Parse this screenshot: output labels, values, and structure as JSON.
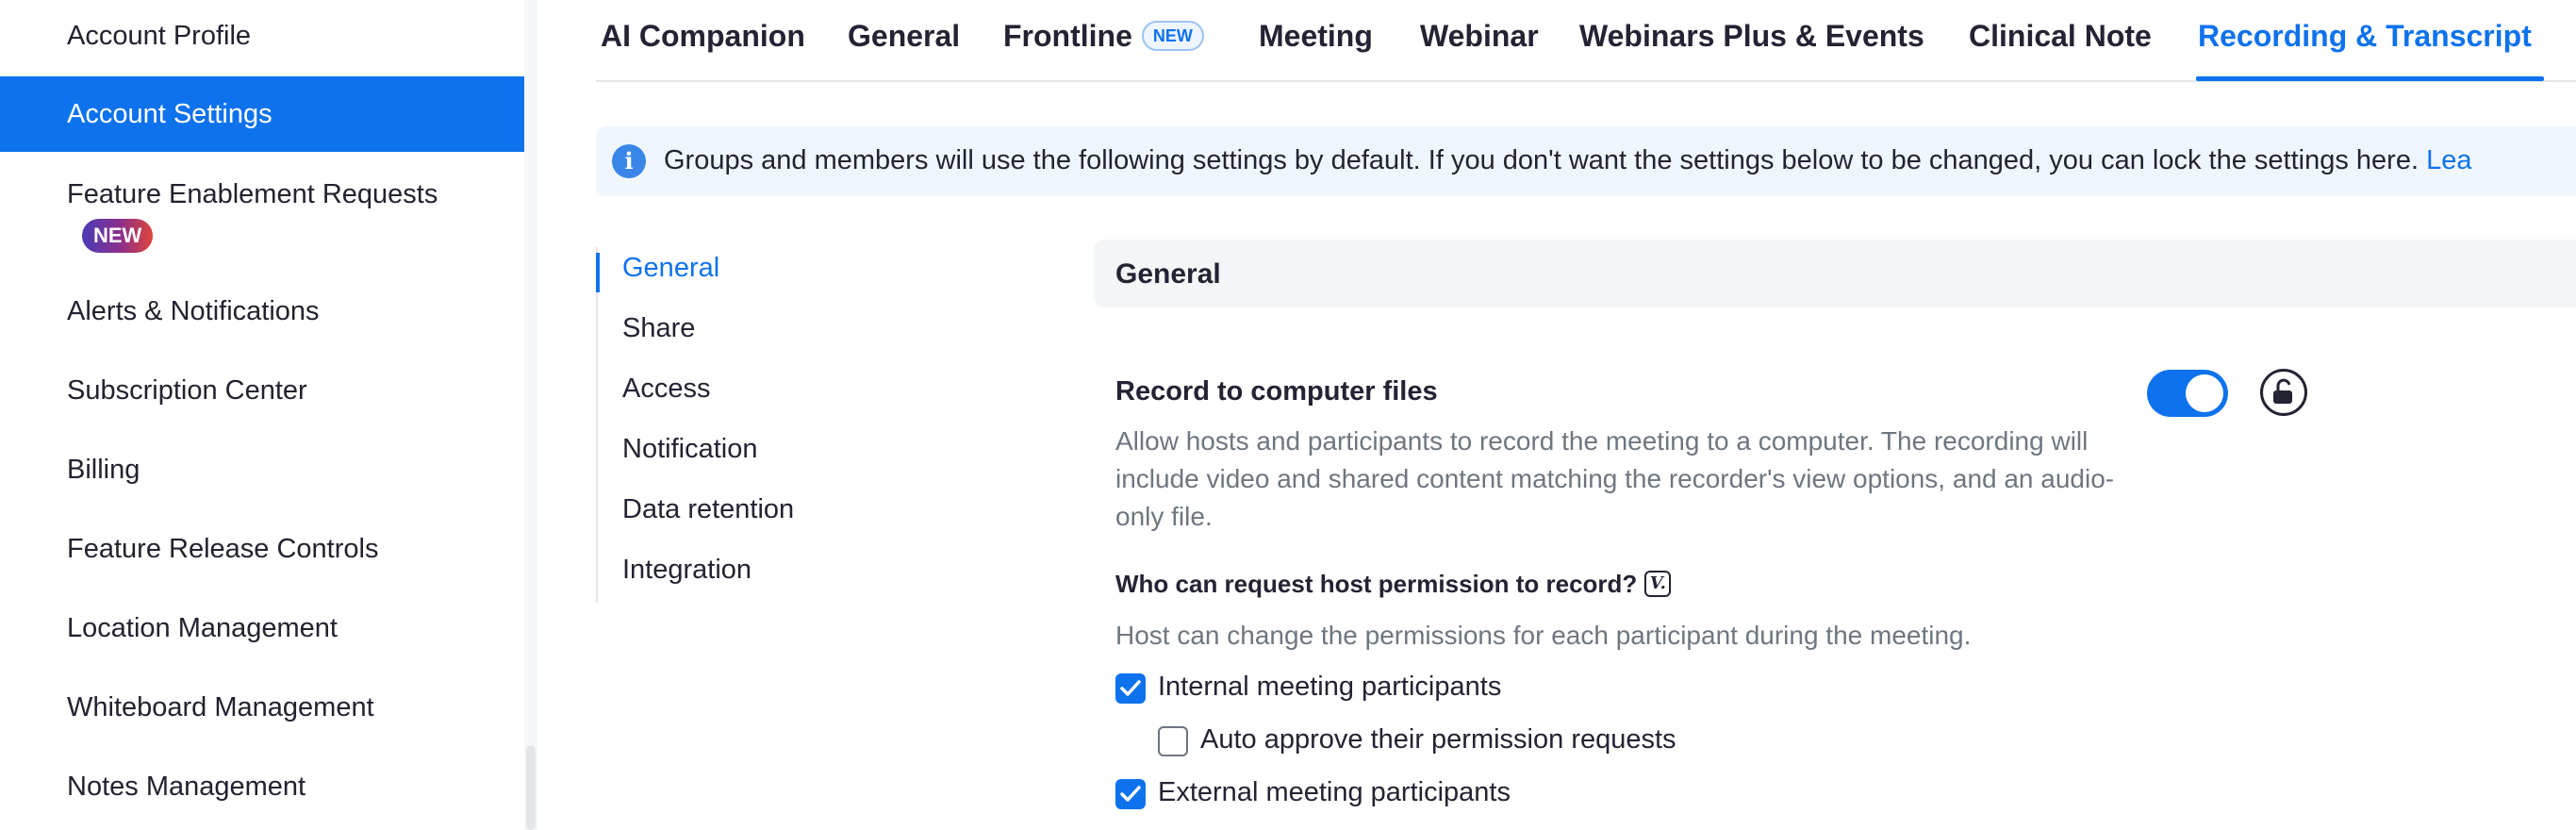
{
  "sidebar": {
    "items": [
      {
        "label": "Account Profile"
      },
      {
        "label": "Account Settings"
      },
      {
        "label": "Feature Enablement Requests",
        "badge": "NEW"
      },
      {
        "label": "Alerts & Notifications"
      },
      {
        "label": "Subscription Center"
      },
      {
        "label": "Billing"
      },
      {
        "label": "Feature Release Controls"
      },
      {
        "label": "Location Management"
      },
      {
        "label": "Whiteboard Management"
      },
      {
        "label": "Notes Management"
      }
    ],
    "active_index": 1
  },
  "tabs": {
    "items": [
      {
        "label": "AI Companion"
      },
      {
        "label": "General"
      },
      {
        "label": "Frontline",
        "badge": "NEW"
      },
      {
        "label": "Meeting"
      },
      {
        "label": "Webinar"
      },
      {
        "label": "Webinars Plus & Events"
      },
      {
        "label": "Clinical Note"
      },
      {
        "label": "Recording & Transcript"
      }
    ],
    "active_index": 7
  },
  "banner": {
    "icon": "info-icon",
    "text": "Groups and members will use the following settings by default. If you don't want the settings below to be changed, you can lock the settings here.",
    "link": "Lea"
  },
  "section_nav": {
    "items": [
      {
        "label": "General"
      },
      {
        "label": "Share"
      },
      {
        "label": "Access"
      },
      {
        "label": "Notification"
      },
      {
        "label": "Data retention"
      },
      {
        "label": "Integration"
      }
    ],
    "active_index": 0
  },
  "section": {
    "title": "General"
  },
  "setting": {
    "title": "Record to computer files",
    "description": "Allow hosts and participants to record the meeting to a computer. The recording will include video and shared content matching the recorder's view options, and an audio-only file.",
    "enabled": true,
    "lock_icon": "unlock-icon",
    "permission": {
      "title": "Who can request host permission to record?",
      "badge": "V.",
      "description": "Host can change the permissions for each participant during the meeting.",
      "options": [
        {
          "label": "Internal meeting participants",
          "checked": true
        },
        {
          "label": "Auto approve their permission requests",
          "checked": false
        },
        {
          "label": "External meeting participants",
          "checked": true
        }
      ]
    }
  },
  "colors": {
    "accent": "#0e72ed",
    "muted_text": "#6e7680",
    "banner_bg": "#f0f6fe"
  }
}
